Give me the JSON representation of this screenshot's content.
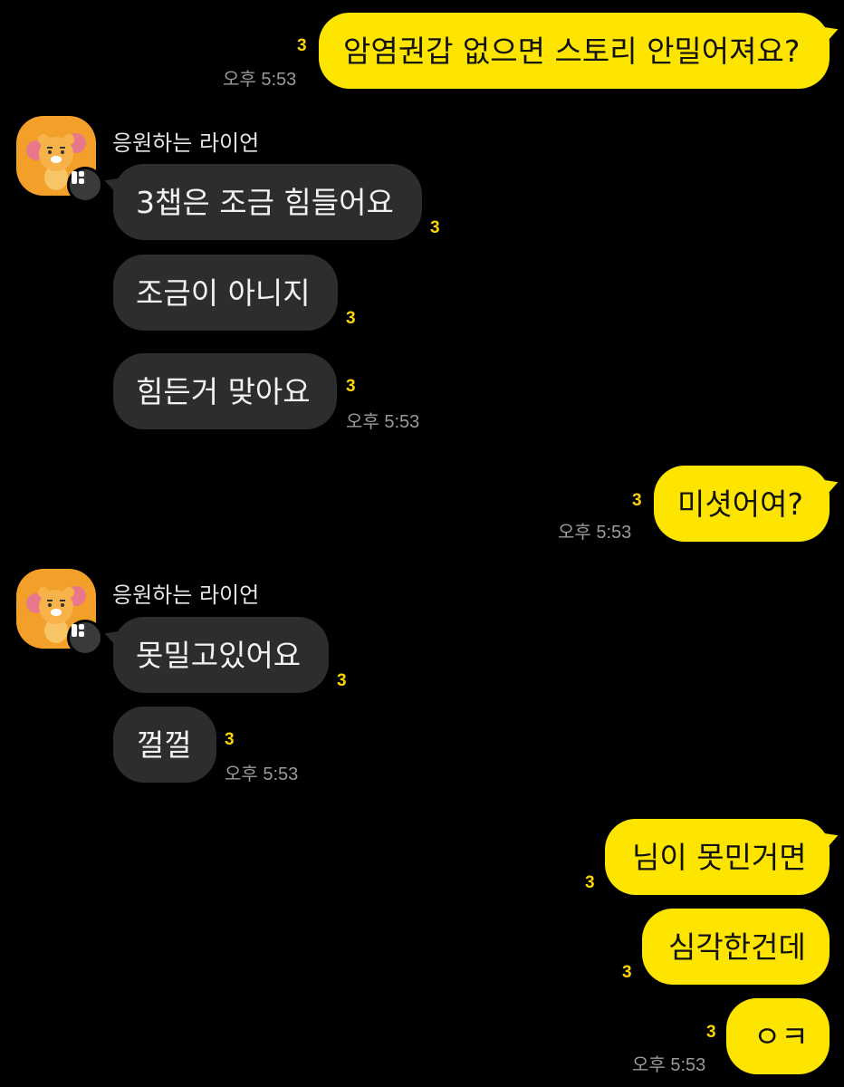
{
  "chat": {
    "read_count": "3",
    "time": "오후 5:53",
    "sender_name": "응원하는 라이언",
    "msg1": "암염권갑 없으면 스토리 안밀어져요?",
    "msg2": "3챕은 조금 힘들어요",
    "msg3": "조금이 아니지",
    "msg4": "힘든거 맞아요",
    "msg5": "미셧어여?",
    "msg6": "못밀고있어요",
    "msg7": "껄껄",
    "msg8": "님이 못민거면",
    "msg9": "심각한건데",
    "msg10": "ㅇㅋ"
  },
  "colors": {
    "my_bubble": "#fee500",
    "their_bubble": "#2d2d2d",
    "unread": "#ffd400",
    "background": "#000000"
  },
  "icons": {
    "avatar": "ryan-cheering-avatar",
    "badge": "chat-badge-icon"
  }
}
